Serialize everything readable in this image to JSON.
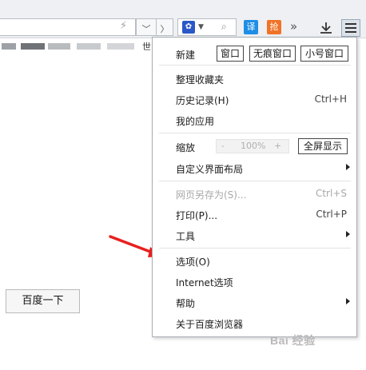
{
  "toolbar": {
    "back_icon": "chevron-down-icon",
    "search_engine_icon": "paw-icon",
    "translate_label": "译",
    "grab_label": "抢",
    "overflow_label": "»",
    "bookmark_fragment": "世",
    "colors": {
      "translate": "#1e8ee6",
      "grab": "#f07326"
    }
  },
  "page": {
    "baidu_button": "百度一下"
  },
  "menu": {
    "new_label": "新建",
    "new_window": "窗口",
    "new_incognito": "无痕窗口",
    "new_small": "小号窗口",
    "organize_favorites": "整理收藏夹",
    "history": "历史记录(H)",
    "history_shortcut": "Ctrl+H",
    "my_apps": "我的应用",
    "zoom_label": "缩放",
    "zoom_minus": "-",
    "zoom_value": "100%",
    "zoom_plus": "+",
    "fullscreen": "全屏显示",
    "customize_layout": "自定义界面布局",
    "save_as": "网页另存为(S)...",
    "save_as_shortcut": "Ctrl+S",
    "print": "打印(P)...",
    "print_shortcut": "Ctrl+P",
    "tools": "工具",
    "options": "选项(O)",
    "internet_options": "Internet选项",
    "help": "帮助",
    "about": "关于百度浏览器"
  },
  "annotation": {
    "arrow_color": "#e8201e"
  },
  "watermark": {
    "text": "Bai 经验"
  }
}
